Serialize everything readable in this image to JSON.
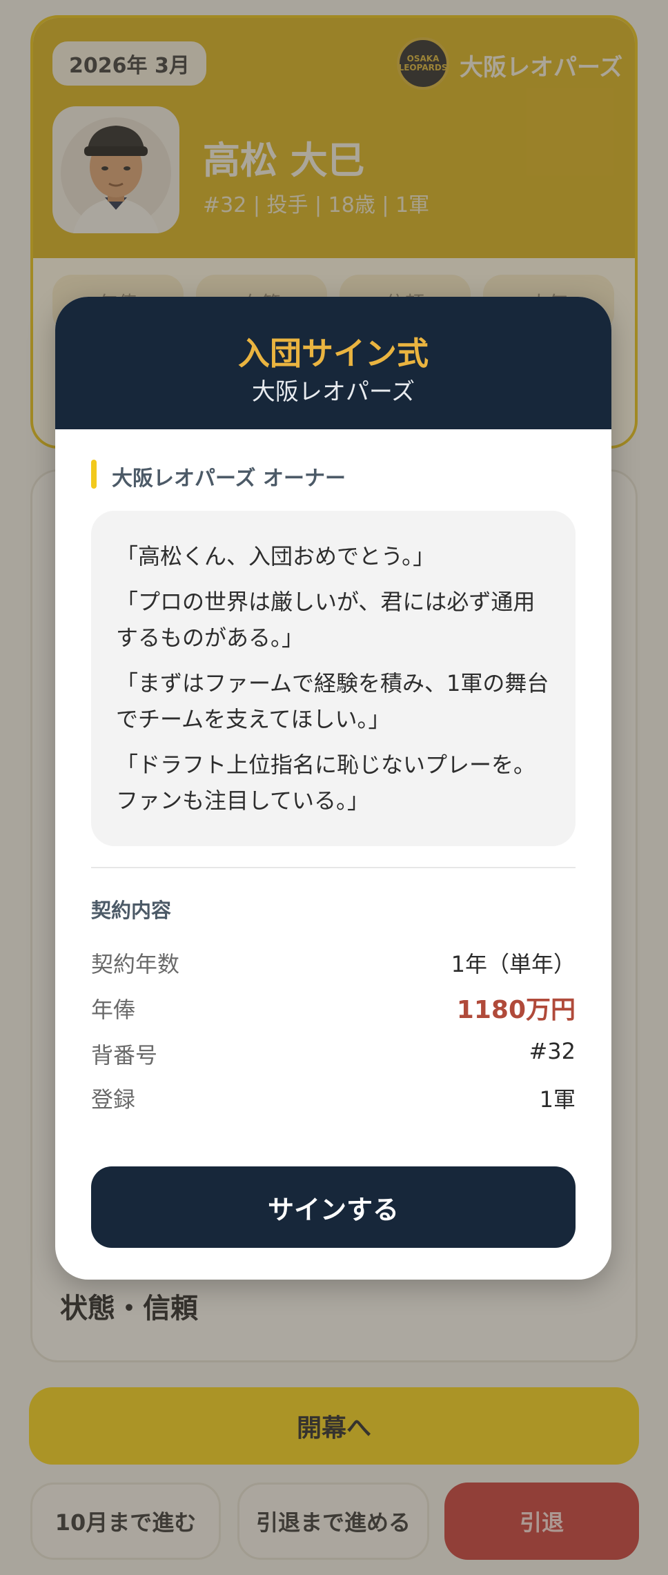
{
  "header": {
    "date": "2026年 3月",
    "team_name": "大阪レオパーズ",
    "logo_text": "OSAKA LEOPARDS"
  },
  "player": {
    "name": "高松 大巳",
    "meta": "#32 | 投手 | 18歳 | 1軍"
  },
  "stat_tabs": [
    "年俸",
    "在籍",
    "信頼",
    "人気"
  ],
  "state_card": {
    "title": "状態・信頼"
  },
  "actions": {
    "open_season": "開幕へ",
    "advance_october": "10月まで進む",
    "advance_retire": "引退まで進める",
    "retire": "引退"
  },
  "modal": {
    "title": "入団サイン式",
    "subtitle": "大阪レオパーズ",
    "speaker": "大阪レオパーズ オーナー",
    "speech": [
      "「高松くん、入団おめでとう。」",
      "「プロの世界は厳しいが、君には必ず通用するものがある。」",
      "「まずはファームで経験を積み、1軍の舞台でチームを支えてほしい。」",
      "「ドラフト上位指名に恥じないプレーを。ファンも注目している。」"
    ],
    "contract_title": "契約内容",
    "contract": {
      "years_label": "契約年数",
      "years_value": "1年（単年）",
      "salary_label": "年俸",
      "salary_value": "1180万円",
      "number_label": "背番号",
      "number_value": "#32",
      "registration_label": "登録",
      "registration_value": "1軍"
    },
    "sign_button": "サインする"
  }
}
